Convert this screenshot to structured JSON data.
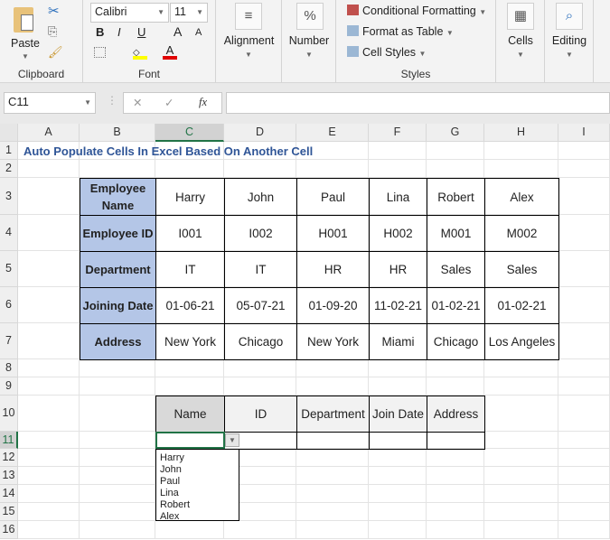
{
  "ribbon": {
    "clipboard": {
      "paste": "Paste",
      "label": "Clipboard"
    },
    "font": {
      "name": "Calibri",
      "size": "11",
      "bold": "B",
      "italic": "I",
      "underline": "U",
      "grow": "A",
      "shrink": "A",
      "font_color": "A",
      "label": "Font",
      "fill_color": "#ffff00",
      "text_color": "#e00000"
    },
    "alignment": {
      "label": "Alignment"
    },
    "number": {
      "label": "Number",
      "icon": "%"
    },
    "styles": {
      "conditional": "Conditional Formatting",
      "format_table": "Format as Table",
      "cell_styles": "Cell Styles",
      "label": "Styles"
    },
    "cells": {
      "label": "Cells"
    },
    "editing": {
      "label": "Editing"
    }
  },
  "formula_bar": {
    "name_box": "C11",
    "cancel": "✕",
    "enter": "✓",
    "fx": "fx",
    "value": ""
  },
  "columns": [
    "A",
    "B",
    "C",
    "D",
    "E",
    "F",
    "G",
    "H",
    "I"
  ],
  "rows": [
    "1",
    "2",
    "3",
    "4",
    "5",
    "6",
    "7",
    "8",
    "9",
    "10",
    "11",
    "12",
    "13",
    "14",
    "15",
    "16"
  ],
  "sheet": {
    "title": "Auto Populate Cells In Excel Based On Another Cell",
    "table1": [
      [
        "Employee Name",
        "Harry",
        "John",
        "Paul",
        "Lina",
        "Robert",
        "Alex"
      ],
      [
        "Employee ID",
        "I001",
        "I002",
        "H001",
        "H002",
        "M001",
        "M002"
      ],
      [
        "Department",
        "IT",
        "IT",
        "HR",
        "HR",
        "Sales",
        "Sales"
      ],
      [
        "Joining Date",
        "01-06-21",
        "05-07-21",
        "01-09-20",
        "11-02-21",
        "01-02-21",
        "01-02-21"
      ],
      [
        "Address",
        "New York",
        "Chicago",
        "New York",
        "Miami",
        "Chicago",
        "Los Angeles"
      ]
    ],
    "table2_headers": [
      "Name",
      "ID",
      "Department",
      "Join Date",
      "Address"
    ],
    "dropdown_options": [
      "Harry",
      "John",
      "Paul",
      "Lina",
      "Robert",
      "Alex"
    ]
  },
  "colors": {
    "label_fill": "#b4c6e7",
    "title": "#2f5597",
    "selected": "#217346"
  }
}
